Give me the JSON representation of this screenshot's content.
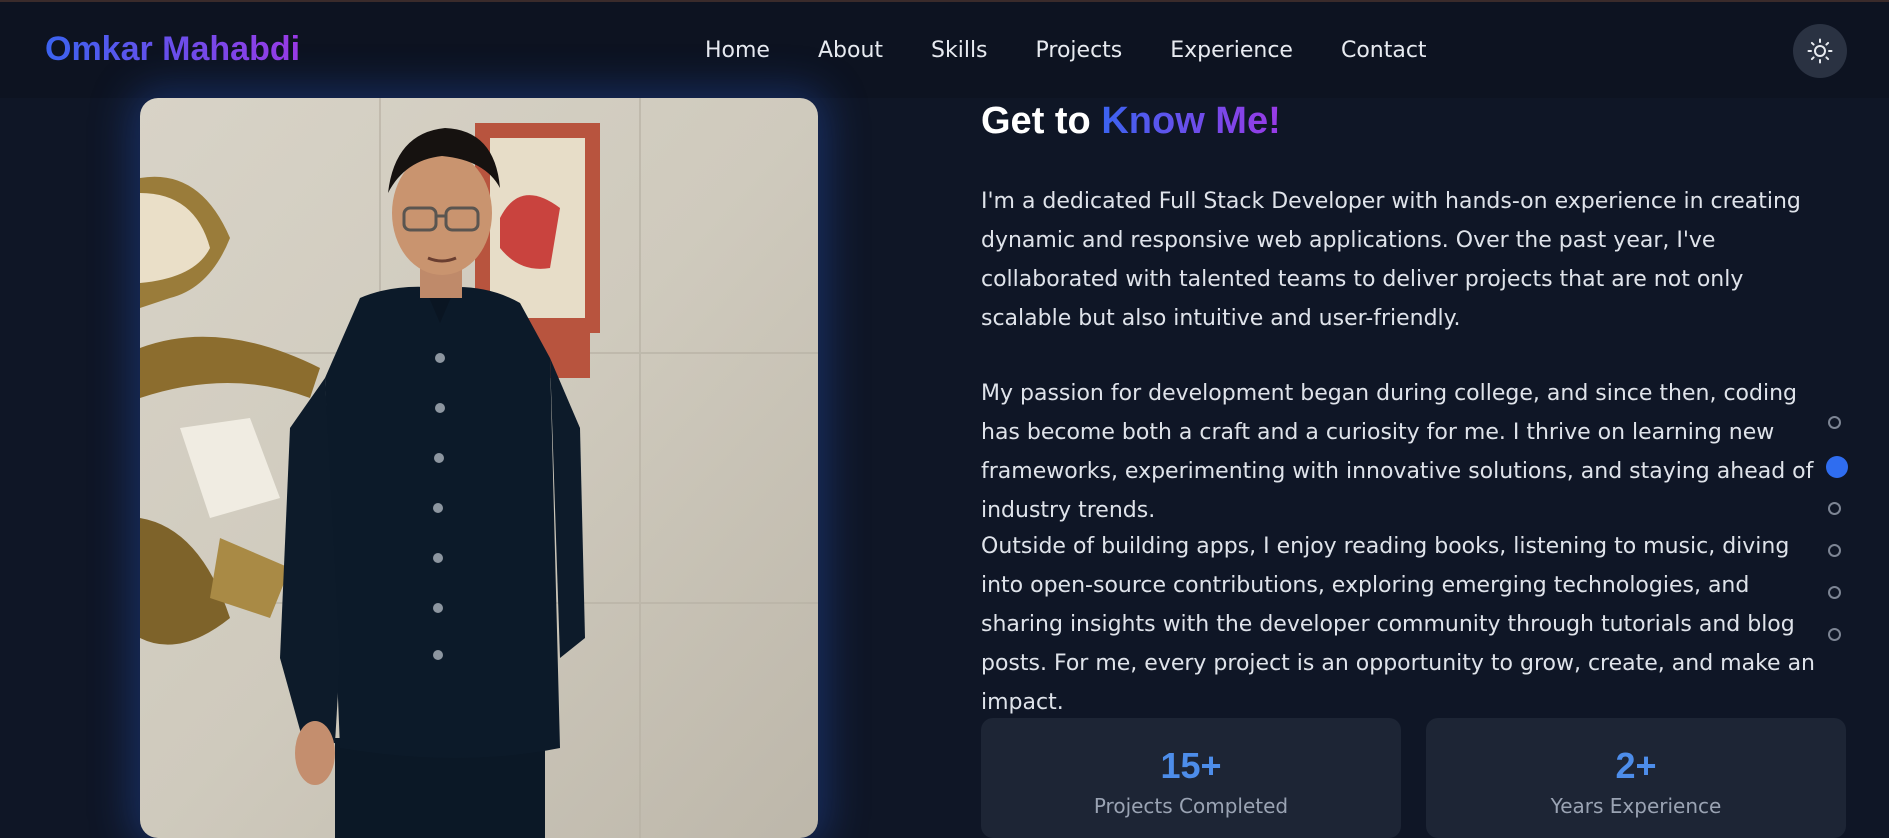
{
  "brand": {
    "name": "Omkar Mahabdi"
  },
  "nav": {
    "items": [
      "Home",
      "About",
      "Skills",
      "Projects",
      "Experience",
      "Contact"
    ],
    "theme_toggle_icon": "sun-icon"
  },
  "about": {
    "title_prefix": "Get to ",
    "title_highlight": "Know Me!",
    "paragraphs": [
      "I'm a dedicated Full Stack Developer with hands-on experience in creating dynamic and responsive web applications. Over the past year, I've collaborated with talented teams to deliver projects that are not only scalable but also intuitive and user-friendly.",
      "My passion for development began during college, and since then, coding has become both a craft and a curiosity for me. I thrive on learning new frameworks, experimenting with innovative solutions, and staying ahead of industry trends.",
      "Outside of building apps, I enjoy reading books, listening to music, diving into open-source contributions, exploring emerging technologies, and sharing insights with the developer community through tutorials and blog posts. For me, every project is an opportunity to grow, create, and make an impact."
    ]
  },
  "stats": [
    {
      "value": "15+",
      "label": "Projects Completed"
    },
    {
      "value": "2+",
      "label": "Years Experience"
    }
  ],
  "section_dots": {
    "count": 6,
    "active_index": 1
  },
  "colors": {
    "background": "#0f1626",
    "accent_blue": "#3b63f0",
    "accent_purple": "#9a3ae6",
    "stat_value": "#4d8dea"
  }
}
